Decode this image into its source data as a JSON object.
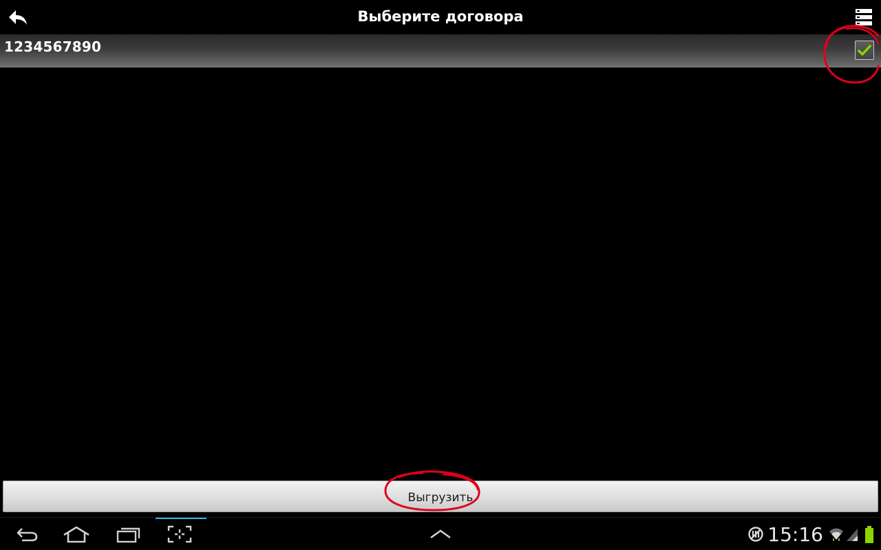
{
  "header": {
    "title": "Выберите договора",
    "back_icon": "back-arrow-icon",
    "menu_icon": "stacked-list-icon"
  },
  "contracts": [
    {
      "number": "1234567890",
      "checked": true
    }
  ],
  "actions": {
    "export_label": "Выгрузить"
  },
  "system_bar": {
    "time": "15:16",
    "buttons": [
      "back-icon",
      "home-icon",
      "recent-apps-icon",
      "screenshot-icon",
      "chevron-up-icon"
    ],
    "status_icons": [
      "no-sync-icon",
      "wifi-icon",
      "signal-icon",
      "battery-icon"
    ]
  },
  "colors": {
    "background": "#000000",
    "annotation": "#e0001b",
    "checkmark": "#8fd400",
    "accent": "#33b5e5"
  }
}
